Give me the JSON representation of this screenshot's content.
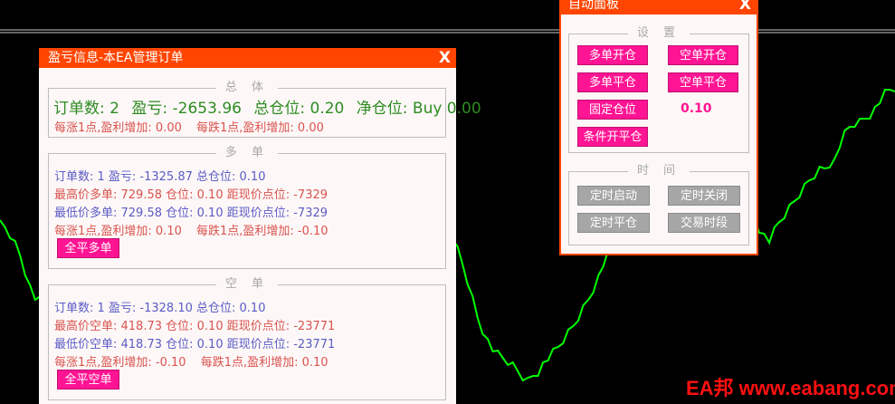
{
  "info_panel": {
    "title": "盈亏信息-本EA管理订单",
    "close": "X",
    "total": {
      "legend": "总 体",
      "orders_label": "订单数:",
      "orders": "2",
      "profit_label": "盈亏:",
      "profit": "-2653.96",
      "lots_label": "总仓位:",
      "lots": "0.20",
      "net_label": "净仓位:",
      "net": "Buy 0.00",
      "per_point": "每涨1点,盈利增加: 0.00",
      "per_point_down": "每跌1点,盈利增加: 0.00"
    },
    "long": {
      "legend": "多 单",
      "summary": "订单数: 1  盈亏: -1325.87  总仓位: 0.10",
      "highest": "最高价多单: 729.58  仓位: 0.10  距现价点位: -7329",
      "lowest": "最低价多单: 729.58  仓位: 0.10  距现价点位: -7329",
      "per_point": "每涨1点,盈利增加: 0.10",
      "per_point_down": "每跌1点,盈利增加: -0.10",
      "close_all": "全平多单"
    },
    "short": {
      "legend": "空 单",
      "summary": "订单数: 1  盈亏: -1328.10  总仓位: 0.10",
      "highest": "最高价空单: 418.73  仓位: 0.10  距现价点位: -23771",
      "lowest": "最低价空单: 418.73  仓位: 0.10  距现价点位: -23771",
      "per_point": "每涨1点,盈利增加: -0.10",
      "per_point_down": "每跌1点,盈利增加: 0.10",
      "close_all": "全平空单"
    }
  },
  "auto_panel": {
    "title": "自动面板",
    "close": "X",
    "settings": {
      "legend": "设 置",
      "buy_open": "多单开仓",
      "sell_open": "空单开仓",
      "buy_close": "多单平仓",
      "sell_close": "空单平仓",
      "fixed_lot": "固定仓位",
      "lot_value": "0.10",
      "conditional_open": "条件开平仓"
    },
    "time": {
      "legend": "时 间",
      "timer_start": "定时启动",
      "timer_stop": "定时关闭",
      "timer_close": "定时平仓",
      "trade_session": "交易时段"
    }
  },
  "chart": {
    "line_color": "#00ff00",
    "background": "#000000",
    "price_series": [
      248,
      252,
      260,
      270,
      282,
      300,
      318,
      330,
      322,
      310,
      298,
      290,
      286,
      292,
      300,
      296,
      290,
      284,
      290,
      298,
      306,
      300,
      294,
      300,
      306,
      312,
      300,
      292,
      296,
      302,
      310,
      306,
      300,
      296,
      302,
      306,
      316,
      310,
      304,
      308,
      312,
      304,
      298,
      294,
      300,
      308,
      316,
      312,
      306,
      300,
      290,
      280,
      270,
      262,
      255,
      250,
      246,
      240,
      236,
      230,
      226,
      224,
      230,
      236,
      232,
      226,
      230,
      236,
      238,
      232,
      226,
      222,
      218,
      214,
      210,
      206,
      202,
      200,
      204,
      210,
      214,
      220,
      226,
      230,
      236,
      240,
      236,
      232,
      240,
      250,
      262,
      276,
      292,
      310,
      330,
      350,
      364,
      376,
      386,
      392,
      396,
      400,
      404,
      410,
      416,
      420,
      414,
      410,
      402,
      396,
      390,
      384,
      376,
      368,
      360,
      350,
      340,
      330,
      318,
      306,
      292,
      280,
      268,
      256,
      248,
      244,
      248,
      256,
      262,
      260,
      254,
      246,
      240,
      236,
      232,
      228,
      222,
      214,
      206,
      198,
      190,
      182,
      178,
      176,
      180,
      188,
      196,
      204,
      214,
      228,
      240,
      252,
      260,
      266,
      256,
      246,
      238,
      230,
      222,
      214,
      206,
      198,
      192,
      186,
      184,
      190,
      176,
      160,
      148,
      140,
      136,
      134,
      130,
      126,
      120,
      112,
      104,
      100,
      98
    ],
    "watermark": "EA邦 www.eabang.com"
  }
}
